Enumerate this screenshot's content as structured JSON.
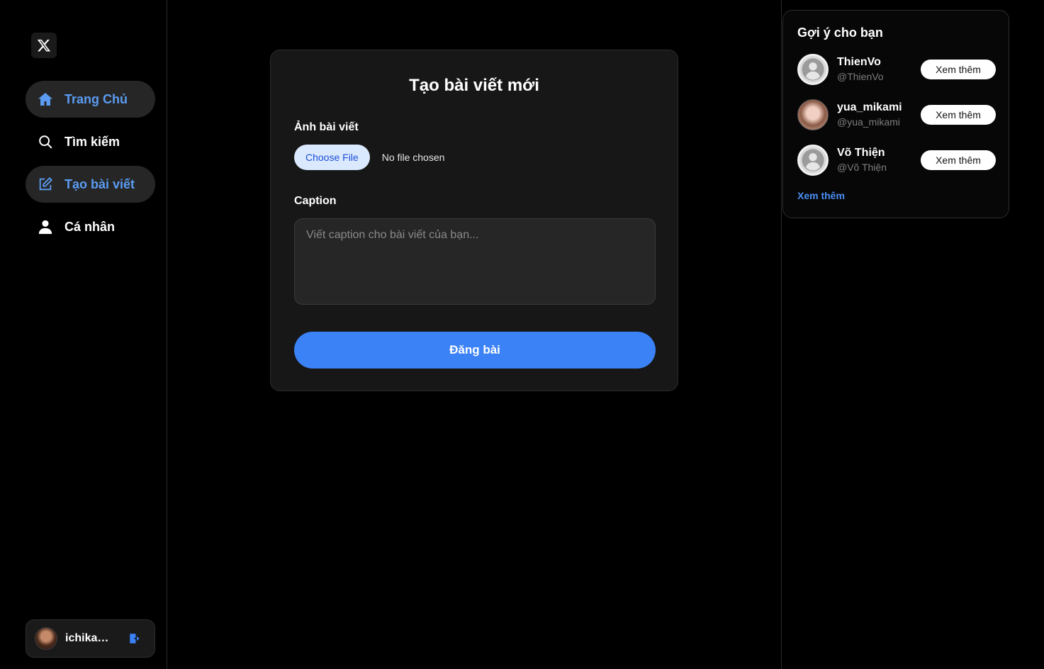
{
  "brand": {
    "logo_icon": "x-logo-icon"
  },
  "sidebar": {
    "items": [
      {
        "label": "Trang Chủ",
        "icon": "home-icon",
        "active": true
      },
      {
        "label": "Tìm kiếm",
        "icon": "search-icon",
        "active": false
      },
      {
        "label": "Tạo bài viết",
        "icon": "edit-icon",
        "active": true
      },
      {
        "label": "Cá nhân",
        "icon": "user-icon",
        "active": false
      }
    ],
    "user": {
      "name": "ichika_...",
      "logout_icon": "logout-icon"
    }
  },
  "create_post": {
    "title": "Tạo bài viết mới",
    "image_label": "Ảnh bài viết",
    "choose_file_label": "Choose File",
    "no_file_text": "No file chosen",
    "caption_label": "Caption",
    "caption_placeholder": "Viết caption cho bài viết của bạn...",
    "caption_value": "",
    "submit_label": "Đăng bài"
  },
  "suggestions": {
    "title": "Gợi ý cho bạn",
    "users": [
      {
        "name": "ThienVo",
        "handle": "@ThienVo",
        "avatar": "default",
        "button": "Xem thêm"
      },
      {
        "name": "yua_mikami",
        "handle": "@yua_mikami",
        "avatar": "photo",
        "button": "Xem thêm"
      },
      {
        "name": "Võ Thiện",
        "handle": "@Võ Thiện",
        "avatar": "default",
        "button": "Xem thêm"
      }
    ],
    "more_label": "Xem thêm"
  },
  "colors": {
    "accent": "#3b82f6",
    "active_text": "#5b9cf2",
    "background": "#000000"
  }
}
